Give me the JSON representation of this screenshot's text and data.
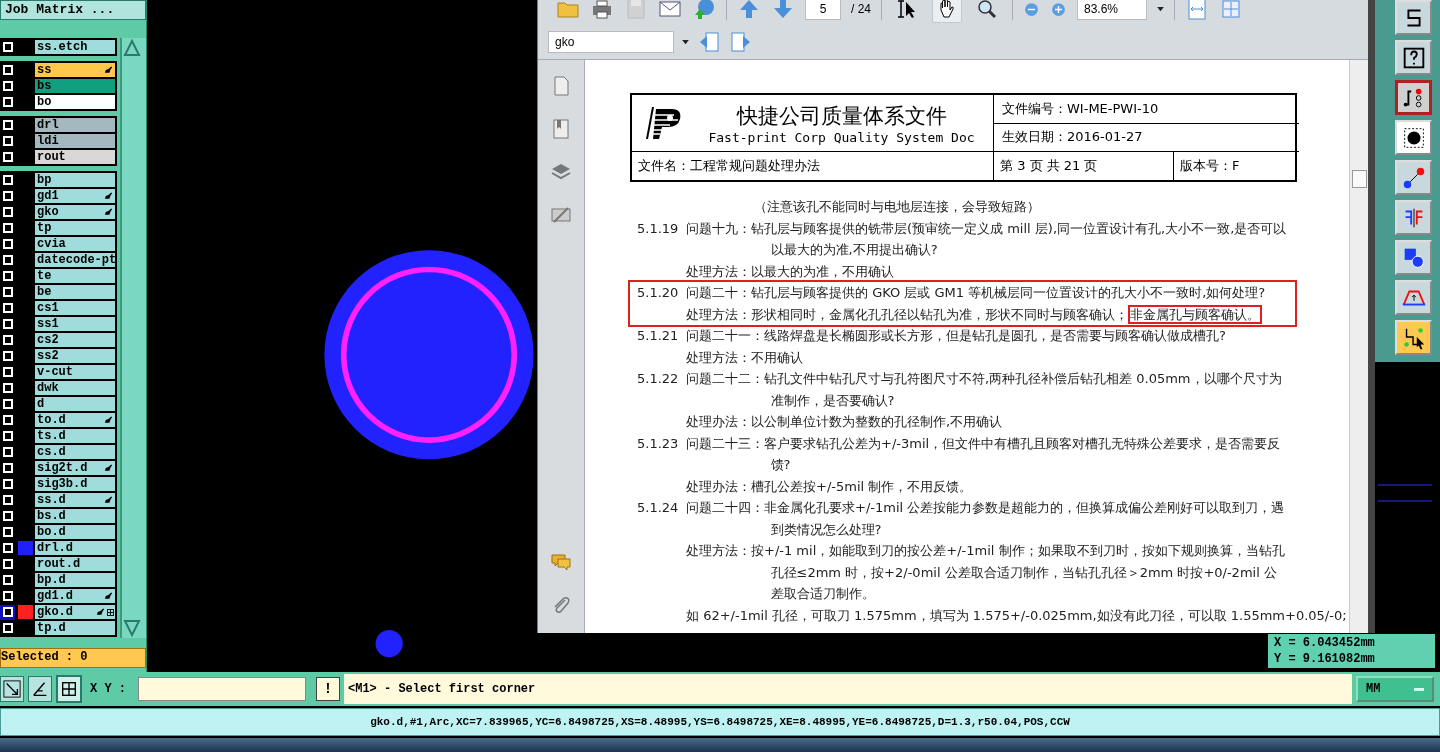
{
  "job_matrix": {
    "title": "Job Matrix ...",
    "groups": [
      {
        "rows": [
          {
            "name": "ss.etch",
            "color": "#a0dcdc",
            "edited": false,
            "checked": false
          }
        ]
      },
      {
        "rows": [
          {
            "name": "ss",
            "color": "#ffc84a",
            "edited": true,
            "checked": false
          },
          {
            "name": "bs",
            "color": "#10a080",
            "edited": false,
            "checked": false
          },
          {
            "name": "bo",
            "color": "#ffffff",
            "edited": false,
            "checked": false
          }
        ]
      },
      {
        "rows": [
          {
            "name": "drl",
            "color": "#a4b8bf",
            "edited": false,
            "checked": false
          },
          {
            "name": "ldi",
            "color": "#a4b8bf",
            "edited": false,
            "checked": false
          },
          {
            "name": "rout",
            "color": "#d8d8d8",
            "edited": false,
            "checked": false
          }
        ]
      },
      {
        "rows": [
          {
            "name": "bp",
            "color": "#a0dcdc",
            "edited": false,
            "checked": false
          },
          {
            "name": "gd1",
            "color": "#a0dcdc",
            "edited": true,
            "checked": false
          },
          {
            "name": "gko",
            "color": "#a0dcdc",
            "edited": true,
            "checked": false
          },
          {
            "name": "tp",
            "color": "#a0dcdc",
            "edited": false,
            "checked": false
          },
          {
            "name": "cvia",
            "color": "#a0dcdc",
            "edited": false,
            "checked": false
          },
          {
            "name": "datecode-pt",
            "color": "#a0dcdc",
            "edited": false,
            "checked": false
          },
          {
            "name": "te",
            "color": "#a0dcdc",
            "edited": false,
            "checked": false
          },
          {
            "name": "be",
            "color": "#a0dcdc",
            "edited": false,
            "checked": false
          },
          {
            "name": "cs1",
            "color": "#a0dcdc",
            "edited": false,
            "checked": false
          },
          {
            "name": "ss1",
            "color": "#a0dcdc",
            "edited": false,
            "checked": false
          },
          {
            "name": "cs2",
            "color": "#a0dcdc",
            "edited": false,
            "checked": false
          },
          {
            "name": "ss2",
            "color": "#a0dcdc",
            "edited": false,
            "checked": false
          },
          {
            "name": "v-cut",
            "color": "#a0dcdc",
            "edited": false,
            "checked": false
          },
          {
            "name": "dwk",
            "color": "#a0dcdc",
            "edited": false,
            "checked": false
          },
          {
            "name": "d",
            "color": "#a0dcdc",
            "edited": false,
            "checked": false
          },
          {
            "name": "to.d",
            "color": "#a0dcdc",
            "edited": true,
            "checked": false
          },
          {
            "name": "ts.d",
            "color": "#a0dcdc",
            "edited": false,
            "checked": false
          },
          {
            "name": "cs.d",
            "color": "#a0dcdc",
            "edited": false,
            "checked": false
          },
          {
            "name": "sig2t.d",
            "color": "#a0dcdc",
            "edited": true,
            "checked": false
          },
          {
            "name": "sig3b.d",
            "color": "#a0dcdc",
            "edited": false,
            "checked": false
          },
          {
            "name": "ss.d",
            "color": "#a0dcdc",
            "edited": true,
            "checked": false
          },
          {
            "name": "bs.d",
            "color": "#a0dcdc",
            "edited": false,
            "checked": false
          },
          {
            "name": "bo.d",
            "color": "#a0dcdc",
            "edited": false,
            "checked": false
          },
          {
            "name": "drl.d",
            "color": "#a0dcdc",
            "edited": false,
            "checked": false,
            "display": {
              "color": "#2020ff"
            }
          },
          {
            "name": "rout.d",
            "color": "#a0dcdc",
            "edited": false,
            "checked": false
          },
          {
            "name": "bp.d",
            "color": "#a0dcdc",
            "edited": false,
            "checked": false
          },
          {
            "name": "gd1.d",
            "color": "#a0dcdc",
            "edited": true,
            "checked": false
          },
          {
            "name": "gko.d",
            "color": "#a0dcdc",
            "edited": true,
            "checked": false,
            "display": {
              "color": "#ff2020"
            },
            "selected": true
          },
          {
            "name": "tp.d",
            "color": "#a0dcdc",
            "edited": false,
            "checked": false
          }
        ]
      }
    ],
    "selected_count": "Selected : 0"
  },
  "pdf_viewer": {
    "page": "5",
    "page_count": "/ 24",
    "zoom": "83.6%",
    "bookmark": "gko",
    "tools": [
      {
        "kind": "select",
        "selected": false
      },
      {
        "kind": "hand",
        "selected": true
      },
      {
        "kind": "zoom",
        "selected": false
      }
    ],
    "document": {
      "company": "快捷公司质量体系文件",
      "company_en": "Fast-print Corp Quality System Doc",
      "doc_no": "文件编号：WI-ME-PWI-10",
      "date": "生效日期：2016-01-27",
      "file_name": "文件名：工程常规问题处理办法",
      "page": "第 3 页 共 21 页",
      "version": "版本号：F",
      "items": [
        {
          "kind": "continuation",
          "text": "（注意该孔不能同时与电地层连接，会导致短路）"
        },
        {
          "kind": "question",
          "number": "5.1.19",
          "question": "问题十九：钻孔层与顾客提供的铣带层(预审统一定义成 mill 层),同一位置设计有孔,大小不一致,是否可以以最大的为准,不用提出确认?",
          "answer": "处理方法：以最大的为准，不用确认",
          "highlighted": false
        },
        {
          "kind": "question",
          "number": "5.1.20",
          "question": "问题二十：钻孔层与顾客提供的 GKO 层或 GM1 等机械层同一位置设计的孔大小不一致时,如何处理?",
          "answer": "处理方法：形状相同时，金属化孔孔径以钻孔为准，形状不同时与顾客确认；",
          "answer_boxed": "非金属孔与顾客确认。",
          "highlighted": true
        },
        {
          "kind": "question",
          "number": "5.1.21",
          "question": "问题二十一：线路焊盘是长椭圆形或长方形，但是钻孔是圆孔，是否需要与顾客确认做成槽孔?",
          "answer": "处理方法：不用确认",
          "highlighted": false
        },
        {
          "kind": "question",
          "number": "5.1.22",
          "question": "问题二十二：钻孔文件中钻孔尺寸与孔符图尺寸不符,两种孔径补偿后钻孔相差 0.05mm，以哪个尺寸为准制作，是否要确认?",
          "answer": "处理办法：以公制单位计数为整数的孔径制作,不用确认",
          "highlighted": false
        },
        {
          "kind": "question",
          "number": "5.1.23",
          "question": "问题二十三：客户要求钻孔公差为+/-3mil，但文件中有槽孔且顾客对槽孔无特殊公差要求，是否需要反馈?",
          "answer": "处理办法：槽孔公差按+/-5mil 制作，不用反馈。",
          "highlighted": false
        },
        {
          "kind": "question",
          "number": "5.1.24",
          "question": "问题二十四：非金属化孔要求+/-1mil 公差按能力参数是超能力的，但换算成偏公差刚好可以取到刀，遇到类情况怎么处理?",
          "answer": "处理方法：按+/-1 mil，如能取到刀的按公差+/-1mil 制作；如果取不到刀时，按如下规则换算，当钻孔孔径≤2mm 时，按+2/-0mil 公差取合适刀制作，当钻孔孔径＞2mm 时按+0/-2mil 公差取合适刀制作。",
          "highlighted": false
        },
        {
          "kind": "note",
          "text": "如 62+/-1mil 孔径，可取刀 1.575mm，填写为 1.575+/-0.025mm,如没有此刀径，可以取 1.55mm+0.05/-0;"
        }
      ]
    }
  },
  "readout": {
    "x": "X = 6.043452mm",
    "y": "Y = 9.161082mm"
  },
  "command_bar": {
    "xy_label": "X Y :",
    "alert": "!",
    "message": "<M1> - Select first corner",
    "unit": "MM"
  },
  "status_bar": "gko.d,#1,Arc,XC=7.839965,YC=6.8498725,XS=8.48995,YS=6.8498725,XE=8.48995,YE=6.8498725,D=1.3,r50.04,POS,CCW"
}
